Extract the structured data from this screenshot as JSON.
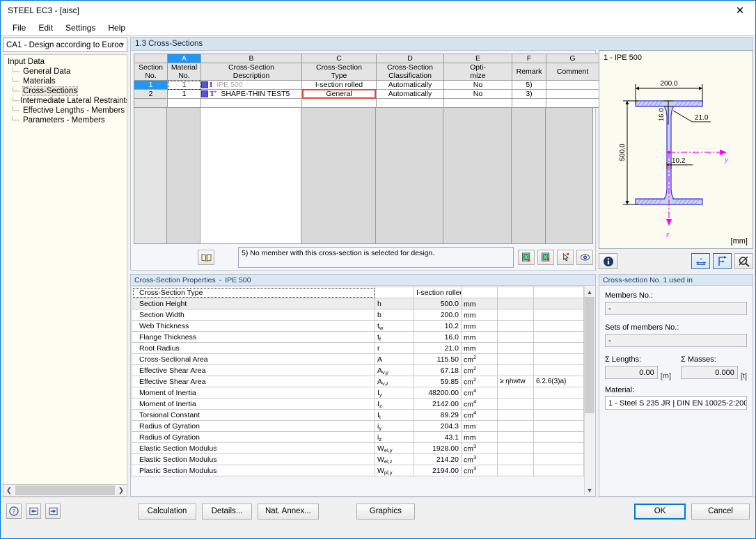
{
  "window": {
    "title": "STEEL EC3 - [aisc]",
    "close_icon": "close-icon"
  },
  "menu": [
    "File",
    "Edit",
    "Settings",
    "Help"
  ],
  "sidebar": {
    "combo_value": "CA1 - Design according to Euroc",
    "root": "Input Data",
    "items": [
      {
        "label": "General Data"
      },
      {
        "label": "Materials"
      },
      {
        "label": "Cross-Sections"
      },
      {
        "label": "Intermediate Lateral Restraints"
      },
      {
        "label": "Effective Lengths - Members"
      },
      {
        "label": "Parameters - Members"
      }
    ],
    "selected": "Cross-Sections"
  },
  "main": {
    "section_title": "1.3 Cross-Sections",
    "grid": {
      "column_letters": [
        "",
        "A",
        "B",
        "C",
        "D",
        "E",
        "F",
        "G"
      ],
      "headers": [
        "Section\nNo.",
        "Material\nNo.",
        "Cross-Section\nDescription",
        "Cross-Section\nType",
        "Cross-Section\nClassification",
        "Opti-\nmize",
        "Remark",
        "Comment"
      ],
      "headers_l1": [
        "Section",
        "Material",
        "Cross-Section",
        "Cross-Section",
        "Cross-Section",
        "Opti-",
        "",
        ""
      ],
      "headers_l2": [
        "No.",
        "No.",
        "Description",
        "Type",
        "Classification",
        "mize",
        "Remark",
        "Comment"
      ],
      "rows": [
        {
          "no": "1",
          "material_no": "1",
          "glyph": "I",
          "description": "IPE 500",
          "type": "I-section rolled",
          "classification": "Automatically",
          "optimize": "No",
          "remark": "5)",
          "comment": ""
        },
        {
          "no": "2",
          "material_no": "1",
          "glyph": "T'",
          "description": "SHAPE-THIN TEST5",
          "type": "General",
          "classification": "Automatically",
          "optimize": "No",
          "remark": "3)",
          "comment": ""
        }
      ]
    },
    "note": "5) No member with this cross-section is selected for design.",
    "note_buttons": [
      {
        "icon": "book-icon",
        "name": "library-button"
      },
      {
        "icon": "export-excel-up-icon",
        "name": "import-button"
      },
      {
        "icon": "export-excel-down-icon",
        "name": "export-button"
      },
      {
        "icon": "pick-section-icon",
        "name": "pick-button"
      },
      {
        "icon": "view-icon",
        "name": "view-button"
      }
    ]
  },
  "graphic": {
    "title": "1 - IPE 500",
    "unit": "[mm]",
    "dimensions": {
      "width": "200.0",
      "height": "500.0",
      "flange_thickness": "16.0",
      "web_thickness": "10.2",
      "root_radius": "21.0"
    },
    "axes": {
      "y": "y",
      "z": "z"
    },
    "toolbar": [
      {
        "icon": "info-icon",
        "name": "info-button"
      },
      {
        "icon": "dimension-x-icon",
        "name": "show-dimensions-button"
      },
      {
        "icon": "axes-icon",
        "name": "show-axes-button"
      },
      {
        "icon": "zoom-reset-icon",
        "name": "reset-zoom-button"
      }
    ]
  },
  "properties": {
    "header_label": "Cross-Section Properties",
    "header_section": "IPE 500",
    "type_label": "Cross-Section Type",
    "type_value": "I-section rolled",
    "rows": [
      {
        "name": "Section Height",
        "sym": "h",
        "sub": "",
        "val": "500.0",
        "unit": "mm",
        "unit_sup": "",
        "cond": "",
        "ref": ""
      },
      {
        "name": "Section Width",
        "sym": "b",
        "sub": "",
        "val": "200.0",
        "unit": "mm",
        "unit_sup": "",
        "cond": "",
        "ref": ""
      },
      {
        "name": "Web Thickness",
        "sym": "t",
        "sub": "w",
        "val": "10.2",
        "unit": "mm",
        "unit_sup": "",
        "cond": "",
        "ref": ""
      },
      {
        "name": "Flange Thickness",
        "sym": "t",
        "sub": "f",
        "val": "16.0",
        "unit": "mm",
        "unit_sup": "",
        "cond": "",
        "ref": ""
      },
      {
        "name": "Root Radius",
        "sym": "r",
        "sub": "",
        "val": "21.0",
        "unit": "mm",
        "unit_sup": "",
        "cond": "",
        "ref": ""
      },
      {
        "name": "Cross-Sectional Area",
        "sym": "A",
        "sub": "",
        "val": "115.50",
        "unit": "cm",
        "unit_sup": "2",
        "cond": "",
        "ref": ""
      },
      {
        "name": "Effective Shear Area",
        "sym": "A",
        "sub": "v,y",
        "val": "67.18",
        "unit": "cm",
        "unit_sup": "2",
        "cond": "",
        "ref": ""
      },
      {
        "name": "Effective Shear Area",
        "sym": "A",
        "sub": "v,z",
        "val": "59.85",
        "unit": "cm",
        "unit_sup": "2",
        "cond": "≥ ηhwtw",
        "ref": "6.2.6(3)a)"
      },
      {
        "name": "Moment of Inertia",
        "sym": "I",
        "sub": "y",
        "val": "48200.00",
        "unit": "cm",
        "unit_sup": "4",
        "cond": "",
        "ref": ""
      },
      {
        "name": "Moment of Inertia",
        "sym": "I",
        "sub": "z",
        "val": "2142.00",
        "unit": "cm",
        "unit_sup": "4",
        "cond": "",
        "ref": ""
      },
      {
        "name": "Torsional Constant",
        "sym": "I",
        "sub": "t",
        "val": "89.29",
        "unit": "cm",
        "unit_sup": "4",
        "cond": "",
        "ref": ""
      },
      {
        "name": "Radius of Gyration",
        "sym": "i",
        "sub": "y",
        "val": "204.3",
        "unit": "mm",
        "unit_sup": "",
        "cond": "",
        "ref": ""
      },
      {
        "name": "Radius of Gyration",
        "sym": "i",
        "sub": "z",
        "val": "43.1",
        "unit": "mm",
        "unit_sup": "",
        "cond": "",
        "ref": ""
      },
      {
        "name": "Elastic Section Modulus",
        "sym": "W",
        "sub": "el,y",
        "val": "1928.00",
        "unit": "cm",
        "unit_sup": "3",
        "cond": "",
        "ref": ""
      },
      {
        "name": "Elastic Section Modulus",
        "sym": "W",
        "sub": "el,z",
        "val": "214.20",
        "unit": "cm",
        "unit_sup": "3",
        "cond": "",
        "ref": ""
      },
      {
        "name": "Plastic Section Modulus",
        "sym": "W",
        "sub": "pl,y",
        "val": "2194.00",
        "unit": "cm",
        "unit_sup": "3",
        "cond": "",
        "ref": ""
      }
    ]
  },
  "info": {
    "header": "Cross-section No. 1 used in",
    "members_label": "Members No.:",
    "members_value": "-",
    "sets_label": "Sets of members No.:",
    "sets_value": "-",
    "lengths_label": "Σ Lengths:",
    "lengths_value": "0.00",
    "lengths_unit": "[m]",
    "masses_label": "Σ Masses:",
    "masses_value": "0.000",
    "masses_unit": "[t]",
    "material_label": "Material:",
    "material_value": "1 - Steel S 235 JR | DIN EN 10025-2:200"
  },
  "footer": {
    "help_icon": "help-icon",
    "prev_icon": "previous-icon",
    "next_icon": "next-icon",
    "calculation": "Calculation",
    "details": "Details...",
    "nat_annex": "Nat. Annex...",
    "graphics": "Graphics",
    "ok": "OK",
    "cancel": "Cancel"
  },
  "colors": {
    "accent": "#2196f3",
    "header_blue": "#d6e4f0",
    "highlight_red": "#e8453c",
    "section_fill": "#5b4fe0",
    "axis_magenta": "#ff00ff"
  }
}
